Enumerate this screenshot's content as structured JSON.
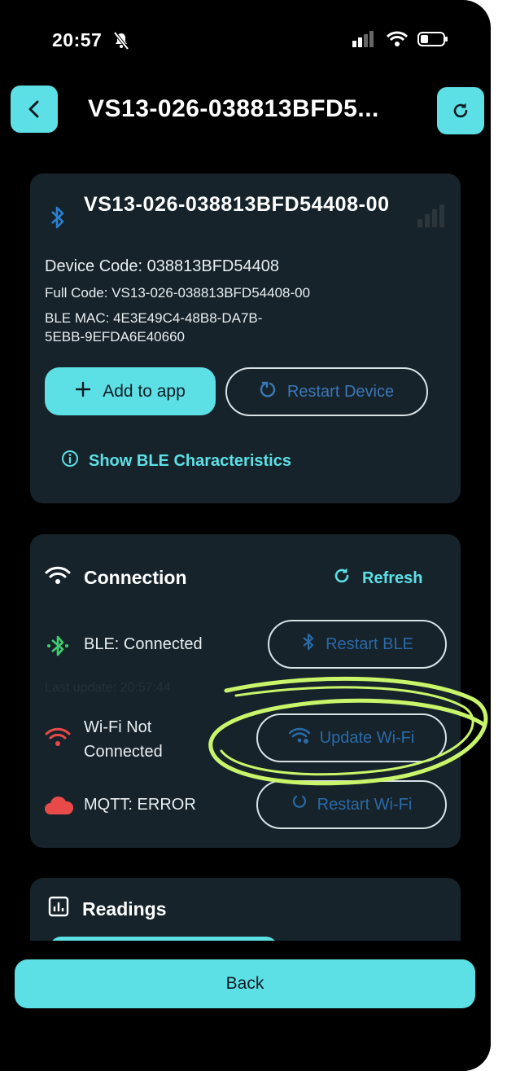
{
  "status_bar": {
    "time": "20:57"
  },
  "header": {
    "title": "VS13-026-038813BFD5..."
  },
  "device": {
    "name": "VS13-026-038813BFD54408-00",
    "device_code": "Device Code: 038813BFD54408",
    "full_code": "Full Code: VS13-026-038813BFD54408-00",
    "ble_mac": "BLE MAC: 4E3E49C4-48B8-DA7B-5EBB-9EFDA6E40660",
    "add_label": "Add to app",
    "restart_label": "Restart Device",
    "show_ble_label": "Show BLE Characteristics"
  },
  "connection": {
    "title": "Connection",
    "refresh_label": "Refresh",
    "ble_status": "BLE: Connected",
    "restart_ble_label": "Restart BLE",
    "last_update": "Last update: 20:57:44",
    "wifi_status": "Wi-Fi Not Connected",
    "update_wifi_label": "Update Wi-Fi",
    "mqtt_status": "MQTT: ERROR",
    "restart_wifi_label": "Restart Wi-Fi"
  },
  "readings": {
    "title": "Readings"
  },
  "footer": {
    "back_label": "Back"
  },
  "colors": {
    "accent": "#5ce0e6",
    "card": "#16232a",
    "bluetooth_blue": "#2a7fcf",
    "ble_green": "#3ecf6e",
    "error_red": "#e84a4a",
    "highlight": "#c9f56a"
  }
}
